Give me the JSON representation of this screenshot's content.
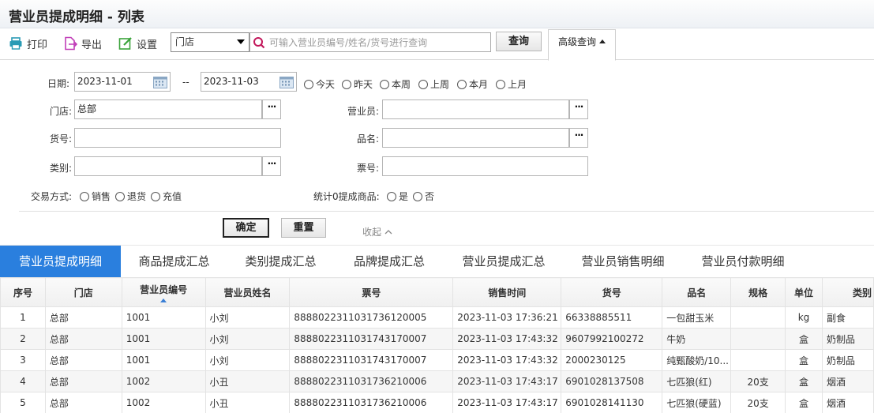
{
  "title": "营业员提成明细 - 列表",
  "toolbar": {
    "print": "打印",
    "export": "导出",
    "settings": "设置",
    "store_select": "门店",
    "search_placeholder": "可输入营业员编号/姓名/货号进行查询",
    "query": "查询",
    "advanced": "高级查询"
  },
  "filters": {
    "date_label": "日期:",
    "date_from": "2023-11-01",
    "date_sep": "--",
    "date_to": "2023-11-03",
    "quick_dates": [
      "今天",
      "昨天",
      "本周",
      "上周",
      "本月",
      "上月"
    ],
    "store_label": "门店:",
    "store_value": "总部",
    "clerk_label": "营业员:",
    "clerk_value": "",
    "sku_label": "货号:",
    "sku_value": "",
    "product_label": "品名:",
    "product_value": "",
    "category_label": "类别:",
    "category_value": "",
    "ticket_label": "票号:",
    "ticket_value": "",
    "trade_label": "交易方式:",
    "trade_options": [
      "销售",
      "退货",
      "充值"
    ],
    "zero_label": "统计0提成商品:",
    "zero_options": [
      "是",
      "否"
    ],
    "confirm": "确定",
    "reset": "重置",
    "collapse": "收起"
  },
  "tabs": [
    "营业员提成明细",
    "商品提成汇总",
    "类别提成汇总",
    "品牌提成汇总",
    "营业员提成汇总",
    "营业员销售明细",
    "营业员付款明细"
  ],
  "table": {
    "columns": [
      "序号",
      "门店",
      "营业员编号",
      "营业员姓名",
      "票号",
      "销售时间",
      "货号",
      "品名",
      "规格",
      "单位",
      "类别"
    ],
    "rows": [
      [
        "1",
        "总部",
        "1001",
        "小刘",
        "8888022311031736120005",
        "2023-11-03 17:36:21",
        "66338885511",
        "一包甜玉米",
        "",
        "kg",
        "副食"
      ],
      [
        "2",
        "总部",
        "1001",
        "小刘",
        "8888022311031743170007",
        "2023-11-03 17:43:32",
        "9607992100272",
        "牛奶",
        "",
        "盒",
        "奶制品"
      ],
      [
        "3",
        "总部",
        "1001",
        "小刘",
        "8888022311031743170007",
        "2023-11-03 17:43:32",
        "2000230125",
        "纯甄酸奶/10...",
        "",
        "盒",
        "奶制品"
      ],
      [
        "4",
        "总部",
        "1002",
        "小丑",
        "8888022311031736210006",
        "2023-11-03 17:43:17",
        "6901028137508",
        "七匹狼(红)",
        "20支",
        "盒",
        "烟酒"
      ],
      [
        "5",
        "总部",
        "1002",
        "小丑",
        "8888022311031736210006",
        "2023-11-03 17:43:17",
        "6901028141130",
        "七匹狼(硬蓝)",
        "20支",
        "盒",
        "烟酒"
      ]
    ]
  }
}
